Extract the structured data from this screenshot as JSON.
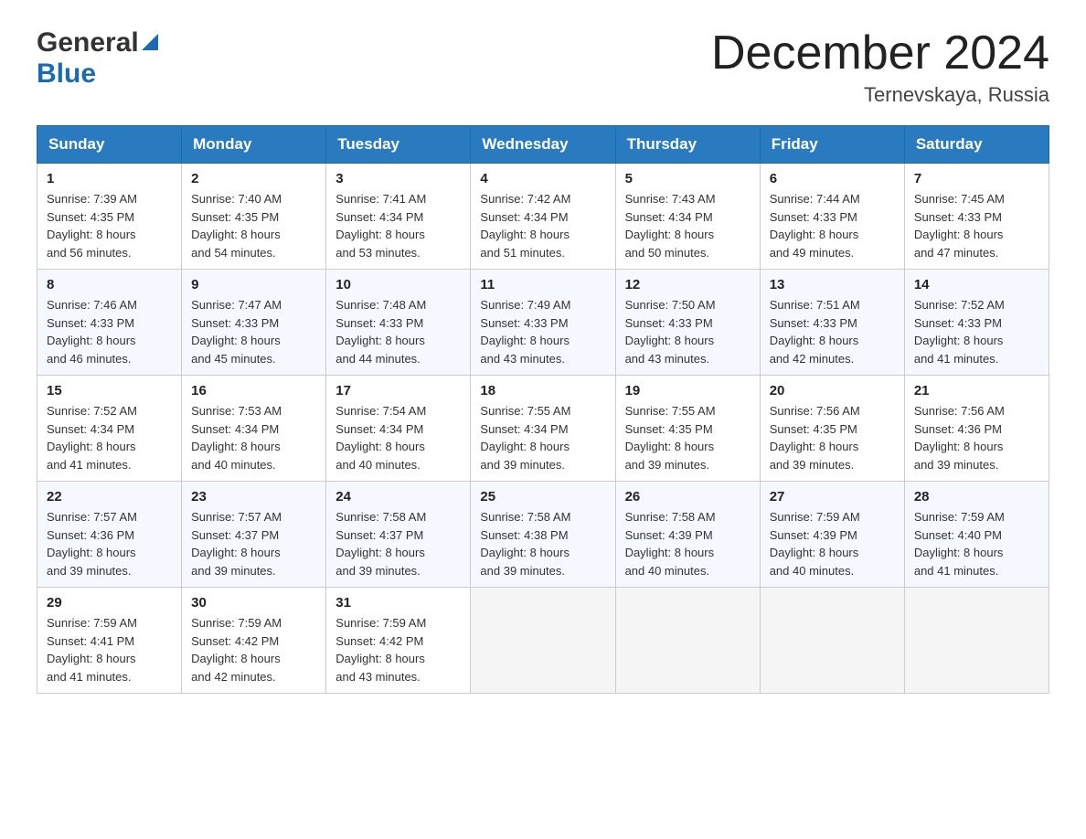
{
  "logo": {
    "general": "General",
    "blue": "Blue"
  },
  "title": {
    "month": "December 2024",
    "location": "Ternevskaya, Russia"
  },
  "headers": [
    "Sunday",
    "Monday",
    "Tuesday",
    "Wednesday",
    "Thursday",
    "Friday",
    "Saturday"
  ],
  "weeks": [
    [
      {
        "day": "1",
        "sunrise": "7:39 AM",
        "sunset": "4:35 PM",
        "daylight": "8 hours and 56 minutes."
      },
      {
        "day": "2",
        "sunrise": "7:40 AM",
        "sunset": "4:35 PM",
        "daylight": "8 hours and 54 minutes."
      },
      {
        "day": "3",
        "sunrise": "7:41 AM",
        "sunset": "4:34 PM",
        "daylight": "8 hours and 53 minutes."
      },
      {
        "day": "4",
        "sunrise": "7:42 AM",
        "sunset": "4:34 PM",
        "daylight": "8 hours and 51 minutes."
      },
      {
        "day": "5",
        "sunrise": "7:43 AM",
        "sunset": "4:34 PM",
        "daylight": "8 hours and 50 minutes."
      },
      {
        "day": "6",
        "sunrise": "7:44 AM",
        "sunset": "4:33 PM",
        "daylight": "8 hours and 49 minutes."
      },
      {
        "day": "7",
        "sunrise": "7:45 AM",
        "sunset": "4:33 PM",
        "daylight": "8 hours and 47 minutes."
      }
    ],
    [
      {
        "day": "8",
        "sunrise": "7:46 AM",
        "sunset": "4:33 PM",
        "daylight": "8 hours and 46 minutes."
      },
      {
        "day": "9",
        "sunrise": "7:47 AM",
        "sunset": "4:33 PM",
        "daylight": "8 hours and 45 minutes."
      },
      {
        "day": "10",
        "sunrise": "7:48 AM",
        "sunset": "4:33 PM",
        "daylight": "8 hours and 44 minutes."
      },
      {
        "day": "11",
        "sunrise": "7:49 AM",
        "sunset": "4:33 PM",
        "daylight": "8 hours and 43 minutes."
      },
      {
        "day": "12",
        "sunrise": "7:50 AM",
        "sunset": "4:33 PM",
        "daylight": "8 hours and 43 minutes."
      },
      {
        "day": "13",
        "sunrise": "7:51 AM",
        "sunset": "4:33 PM",
        "daylight": "8 hours and 42 minutes."
      },
      {
        "day": "14",
        "sunrise": "7:52 AM",
        "sunset": "4:33 PM",
        "daylight": "8 hours and 41 minutes."
      }
    ],
    [
      {
        "day": "15",
        "sunrise": "7:52 AM",
        "sunset": "4:34 PM",
        "daylight": "8 hours and 41 minutes."
      },
      {
        "day": "16",
        "sunrise": "7:53 AM",
        "sunset": "4:34 PM",
        "daylight": "8 hours and 40 minutes."
      },
      {
        "day": "17",
        "sunrise": "7:54 AM",
        "sunset": "4:34 PM",
        "daylight": "8 hours and 40 minutes."
      },
      {
        "day": "18",
        "sunrise": "7:55 AM",
        "sunset": "4:34 PM",
        "daylight": "8 hours and 39 minutes."
      },
      {
        "day": "19",
        "sunrise": "7:55 AM",
        "sunset": "4:35 PM",
        "daylight": "8 hours and 39 minutes."
      },
      {
        "day": "20",
        "sunrise": "7:56 AM",
        "sunset": "4:35 PM",
        "daylight": "8 hours and 39 minutes."
      },
      {
        "day": "21",
        "sunrise": "7:56 AM",
        "sunset": "4:36 PM",
        "daylight": "8 hours and 39 minutes."
      }
    ],
    [
      {
        "day": "22",
        "sunrise": "7:57 AM",
        "sunset": "4:36 PM",
        "daylight": "8 hours and 39 minutes."
      },
      {
        "day": "23",
        "sunrise": "7:57 AM",
        "sunset": "4:37 PM",
        "daylight": "8 hours and 39 minutes."
      },
      {
        "day": "24",
        "sunrise": "7:58 AM",
        "sunset": "4:37 PM",
        "daylight": "8 hours and 39 minutes."
      },
      {
        "day": "25",
        "sunrise": "7:58 AM",
        "sunset": "4:38 PM",
        "daylight": "8 hours and 39 minutes."
      },
      {
        "day": "26",
        "sunrise": "7:58 AM",
        "sunset": "4:39 PM",
        "daylight": "8 hours and 40 minutes."
      },
      {
        "day": "27",
        "sunrise": "7:59 AM",
        "sunset": "4:39 PM",
        "daylight": "8 hours and 40 minutes."
      },
      {
        "day": "28",
        "sunrise": "7:59 AM",
        "sunset": "4:40 PM",
        "daylight": "8 hours and 41 minutes."
      }
    ],
    [
      {
        "day": "29",
        "sunrise": "7:59 AM",
        "sunset": "4:41 PM",
        "daylight": "8 hours and 41 minutes."
      },
      {
        "day": "30",
        "sunrise": "7:59 AM",
        "sunset": "4:42 PM",
        "daylight": "8 hours and 42 minutes."
      },
      {
        "day": "31",
        "sunrise": "7:59 AM",
        "sunset": "4:42 PM",
        "daylight": "8 hours and 43 minutes."
      },
      null,
      null,
      null,
      null
    ]
  ],
  "labels": {
    "sunrise": "Sunrise:",
    "sunset": "Sunset:",
    "daylight": "Daylight:"
  }
}
